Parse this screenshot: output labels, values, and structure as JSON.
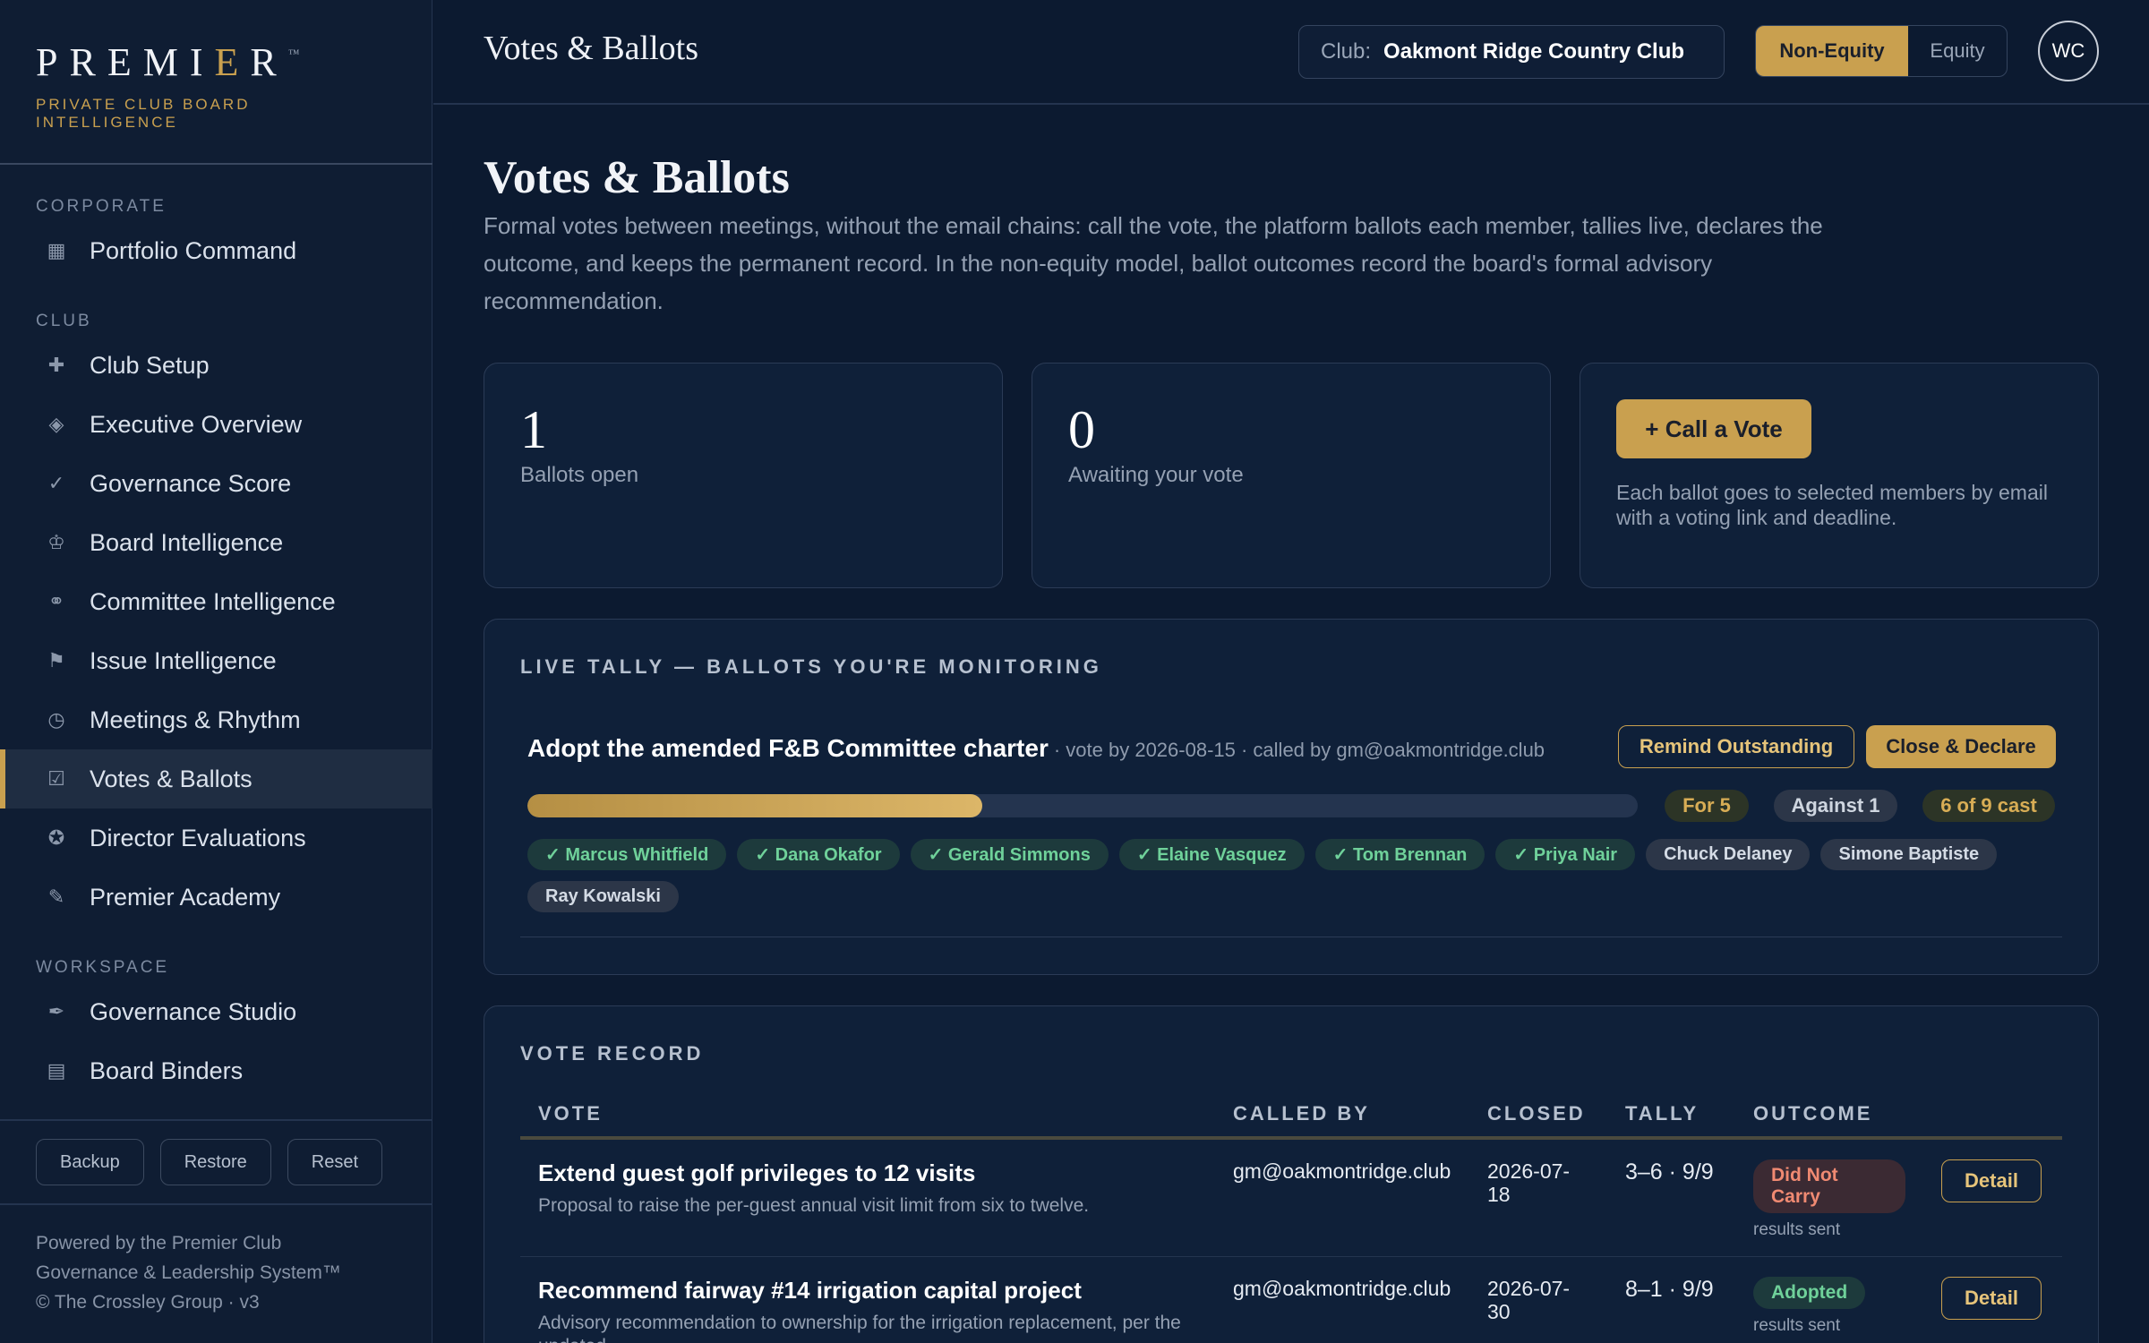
{
  "brand": {
    "name_before": "PREMI",
    "name_accent": "E",
    "name_after": "R",
    "trademark": "™",
    "subtitle": "PRIVATE CLUB BOARD INTELLIGENCE"
  },
  "sidebar": {
    "sections": [
      {
        "label": "CORPORATE",
        "items": [
          {
            "label": "Portfolio Command",
            "icon": "grid-icon"
          }
        ]
      },
      {
        "label": "CLUB",
        "items": [
          {
            "label": "Club Setup",
            "icon": "plus-icon"
          },
          {
            "label": "Executive Overview",
            "icon": "diamond-icon"
          },
          {
            "label": "Governance Score",
            "icon": "check-icon"
          },
          {
            "label": "Board Intelligence",
            "icon": "crown-icon"
          },
          {
            "label": "Committee Intelligence",
            "icon": "link-icon"
          },
          {
            "label": "Issue Intelligence",
            "icon": "flag-icon"
          },
          {
            "label": "Meetings & Rhythm",
            "icon": "clock-icon"
          },
          {
            "label": "Votes & Ballots",
            "icon": "ballot-box-icon",
            "active": true
          },
          {
            "label": "Director Evaluations",
            "icon": "star-badge-icon"
          },
          {
            "label": "Premier Academy",
            "icon": "pencil-icon"
          }
        ]
      },
      {
        "label": "WORKSPACE",
        "items": [
          {
            "label": "Governance Studio",
            "icon": "pen-nib-icon"
          },
          {
            "label": "Board Binders",
            "icon": "binder-icon"
          }
        ]
      }
    ],
    "buttons": {
      "backup": "Backup",
      "restore": "Restore",
      "reset": "Reset"
    },
    "footer": {
      "line1": "Powered by the Premier Club",
      "line2": "Governance & Leadership System™",
      "line3": "© The Crossley Group · v3"
    }
  },
  "topbar": {
    "title": "Votes & Ballots",
    "club_label": "Club:",
    "club_value": "Oakmont Ridge Country Club",
    "toggle_on": "Non-Equity",
    "toggle_off": "Equity",
    "avatar_initials": "WC"
  },
  "page": {
    "title": "Votes & Ballots",
    "description": "Formal votes between meetings, without the email chains: call the vote, the platform ballots each member, tallies live, declares the outcome, and keeps the permanent record. In the non-equity model, ballot outcomes record the board's formal advisory recommendation."
  },
  "stats": {
    "open_count": "1",
    "open_label": "Ballots open",
    "awaiting_count": "0",
    "awaiting_label": "Awaiting your vote",
    "call_button": "+ Call a Vote",
    "call_note": "Each ballot goes to selected members by email with a voting link and deadline."
  },
  "live_tally": {
    "heading": "LIVE TALLY — BALLOTS YOU'RE MONITORING",
    "ballot": {
      "title": "Adopt the amended F&B Committee charter",
      "meta": "· vote by 2026-08-15 · called by gm@oakmontridge.club",
      "remind_button": "Remind Outstanding",
      "close_button": "Close & Declare",
      "progress_fraction": 0.41,
      "for_label": "For 5",
      "against_label": "Against 1",
      "cast_label": "6 of 9 cast",
      "members": [
        {
          "label": "✓ Marcus Whitfield",
          "voted": true
        },
        {
          "label": "✓ Dana Okafor",
          "voted": true
        },
        {
          "label": "✓ Gerald Simmons",
          "voted": true
        },
        {
          "label": "✓ Elaine Vasquez",
          "voted": true
        },
        {
          "label": "✓ Tom Brennan",
          "voted": true
        },
        {
          "label": "✓ Priya Nair",
          "voted": true
        },
        {
          "label": "Chuck Delaney",
          "voted": false
        },
        {
          "label": "Simone Baptiste",
          "voted": false
        },
        {
          "label": "Ray Kowalski",
          "voted": false
        }
      ]
    }
  },
  "vote_record": {
    "heading": "VOTE RECORD",
    "columns": [
      "VOTE",
      "CALLED BY",
      "CLOSED",
      "TALLY",
      "OUTCOME"
    ],
    "rows": [
      {
        "name": "Extend guest golf privileges to 12 visits",
        "desc": "Proposal to raise the per-guest annual visit limit from six to twelve.",
        "called_by": "gm@oakmontridge.club",
        "closed": "2026-07-18",
        "tally": "3–6 · 9/9",
        "outcome": "Did Not Carry",
        "outcome_type": "fail",
        "outcome_note": "results sent",
        "action": "Detail"
      },
      {
        "name": "Recommend fairway #14 irrigation capital project",
        "desc": "Advisory recommendation to ownership for the irrigation replacement, per the updated…",
        "called_by": "gm@oakmontridge.club",
        "closed": "2026-07-30",
        "tally": "8–1 · 9/9",
        "outcome": "Adopted",
        "outcome_type": "pass",
        "outcome_note": "results sent",
        "action": "Detail"
      }
    ]
  },
  "colors": {
    "accent_gold": "#c9a04f",
    "background": "#0c1a30",
    "voted_green": "#6fd19a",
    "fail_red": "#f08a72"
  }
}
